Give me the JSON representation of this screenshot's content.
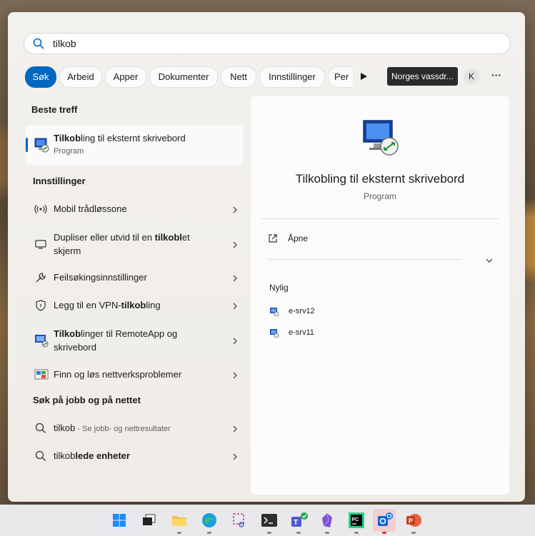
{
  "search": {
    "value": "tilkob"
  },
  "filters": {
    "items": [
      "Søk",
      "Arbeid",
      "Apper",
      "Dokumenter",
      "Nett",
      "Innstillinger",
      "Per"
    ],
    "active": "Søk",
    "tooltip": "Norges vassdr...",
    "avatar_letter": "K",
    "more_label": "···"
  },
  "best_match": {
    "heading": "Beste treff",
    "title_bold": "Tilkob",
    "title_rest": "ling til eksternt skrivebord",
    "subtitle": "Program"
  },
  "settings": {
    "heading": "Innstillinger",
    "items": [
      {
        "pre": "Mobil trådløssone",
        "bold": "",
        "post": "",
        "icon": "hotspot-icon"
      },
      {
        "pre": "Dupliser eller utvid til en ",
        "bold": "tilkobl",
        "post": "et skjerm",
        "icon": "display-icon"
      },
      {
        "pre": "Feilsøkingsinnstillinger",
        "bold": "",
        "post": "",
        "icon": "wrench-icon"
      },
      {
        "pre": "Legg til en VPN-",
        "bold": "tilkob",
        "post": "ling",
        "icon": "shield-icon"
      },
      {
        "pre": "",
        "bold": "Tilkob",
        "post": "linger til RemoteApp og skrivebord",
        "icon": "remoteapp-icon"
      },
      {
        "pre": "Finn og løs nettverksproblemer",
        "bold": "",
        "post": "",
        "icon": "network-troubleshoot-icon"
      }
    ]
  },
  "web": {
    "heading": "Søk på jobb og på nettet",
    "items": [
      {
        "pre": "tilkob",
        "bold": "",
        "post": "",
        "suffix": " - Se jobb- og nettresultater"
      },
      {
        "pre": "tilkob",
        "bold": "lede enheter",
        "post": "",
        "suffix": ""
      }
    ]
  },
  "preview": {
    "title": "Tilkobling til eksternt skrivebord",
    "subtitle": "Program",
    "open_label": "Åpne",
    "recent_heading": "Nylig",
    "recent": [
      "e-srv12",
      "e-srv11"
    ]
  },
  "taskbar": {
    "apps": [
      "start-icon",
      "task-view-icon",
      "file-explorer-icon",
      "edge-icon",
      "snipping-tool-icon",
      "terminal-icon",
      "teams-icon",
      "obsidian-icon",
      "pycharm-icon",
      "outlook-icon",
      "powerpoint-icon"
    ]
  },
  "colors": {
    "accent": "#0067c0",
    "panel": "#fbfbfb"
  }
}
